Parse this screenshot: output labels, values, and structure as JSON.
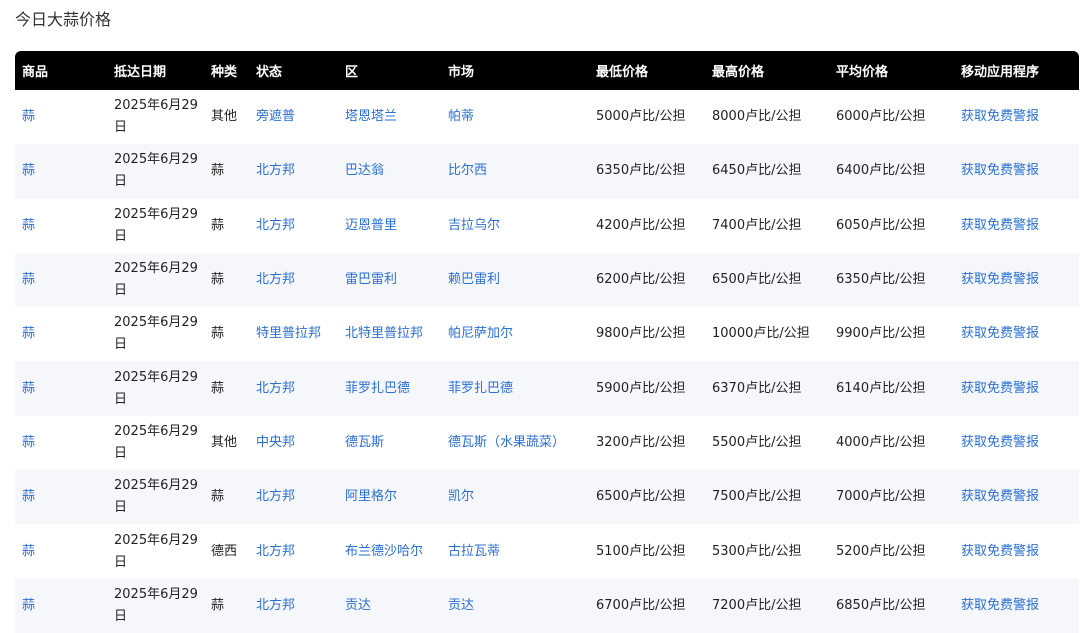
{
  "page": {
    "title": "今日大蒜价格"
  },
  "table": {
    "headers": [
      "商品",
      "抵达日期",
      "种类",
      "状态",
      "区",
      "市场",
      "最低价格",
      "最高价格",
      "平均价格",
      "移动应用程序"
    ],
    "rows": [
      {
        "commodity": "蒜",
        "date": "2025年6月29日",
        "variety": "其他",
        "state": "旁遮普",
        "district": "塔恩塔兰",
        "market": "帕蒂",
        "min": "5000卢比/公担",
        "max": "8000卢比/公担",
        "avg": "6000卢比/公担",
        "app": "获取免费警报"
      },
      {
        "commodity": "蒜",
        "date": "2025年6月29日",
        "variety": "蒜",
        "state": "北方邦",
        "district": "巴达翁",
        "market": "比尔西",
        "min": "6350卢比/公担",
        "max": "6450卢比/公担",
        "avg": "6400卢比/公担",
        "app": "获取免费警报"
      },
      {
        "commodity": "蒜",
        "date": "2025年6月29日",
        "variety": "蒜",
        "state": "北方邦",
        "district": "迈恩普里",
        "market": "吉拉乌尔",
        "min": "4200卢比/公担",
        "max": "7400卢比/公担",
        "avg": "6050卢比/公担",
        "app": "获取免费警报"
      },
      {
        "commodity": "蒜",
        "date": "2025年6月29日",
        "variety": "蒜",
        "state": "北方邦",
        "district": "雷巴雷利",
        "market": "赖巴雷利",
        "min": "6200卢比/公担",
        "max": "6500卢比/公担",
        "avg": "6350卢比/公担",
        "app": "获取免费警报"
      },
      {
        "commodity": "蒜",
        "date": "2025年6月29日",
        "variety": "蒜",
        "state": "特里普拉邦",
        "district": "北特里普拉邦",
        "market": "帕尼萨加尔",
        "min": "9800卢比/公担",
        "max": "10000卢比/公担",
        "avg": "9900卢比/公担",
        "app": "获取免费警报"
      },
      {
        "commodity": "蒜",
        "date": "2025年6月29日",
        "variety": "蒜",
        "state": "北方邦",
        "district": "菲罗扎巴德",
        "market": "菲罗扎巴德",
        "min": "5900卢比/公担",
        "max": "6370卢比/公担",
        "avg": "6140卢比/公担",
        "app": "获取免费警报"
      },
      {
        "commodity": "蒜",
        "date": "2025年6月29日",
        "variety": "其他",
        "state": "中央邦",
        "district": "德瓦斯",
        "market": "德瓦斯（水果蔬菜）",
        "min": "3200卢比/公担",
        "max": "5500卢比/公担",
        "avg": "4000卢比/公担",
        "app": "获取免费警报"
      },
      {
        "commodity": "蒜",
        "date": "2025年6月29日",
        "variety": "蒜",
        "state": "北方邦",
        "district": "阿里格尔",
        "market": "凯尔",
        "min": "6500卢比/公担",
        "max": "7500卢比/公担",
        "avg": "7000卢比/公担",
        "app": "获取免费警报"
      },
      {
        "commodity": "蒜",
        "date": "2025年6月29日",
        "variety": "德西",
        "state": "北方邦",
        "district": "布兰德沙哈尔",
        "market": "古拉瓦蒂",
        "min": "5100卢比/公担",
        "max": "5300卢比/公担",
        "avg": "5200卢比/公担",
        "app": "获取免费警报"
      },
      {
        "commodity": "蒜",
        "date": "2025年6月29日",
        "variety": "蒜",
        "state": "北方邦",
        "district": "贡达",
        "market": "贡达",
        "min": "6700卢比/公担",
        "max": "7200卢比/公担",
        "avg": "6850卢比/公担",
        "app": "获取免费警报"
      }
    ]
  }
}
